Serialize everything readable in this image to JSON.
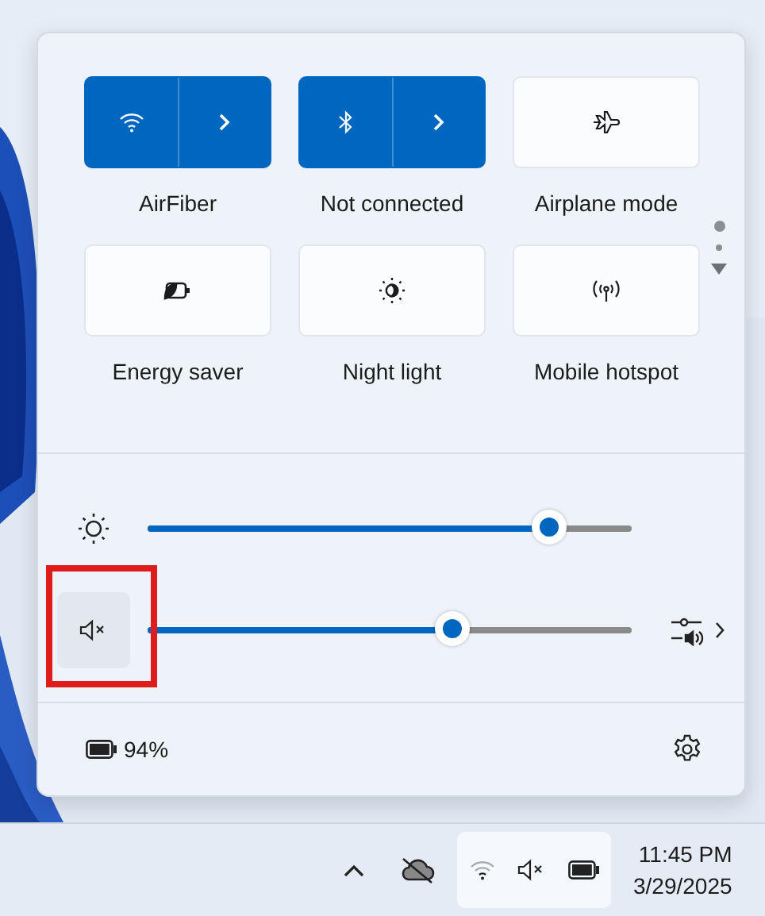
{
  "quick_settings": {
    "tiles": [
      {
        "kind": "split",
        "label": "AirFiber",
        "selected": true
      },
      {
        "kind": "split",
        "label": "Not connected",
        "selected": true
      },
      {
        "kind": "single",
        "label": "Airplane mode",
        "selected": false
      },
      {
        "kind": "single",
        "label": "Energy saver",
        "selected": false
      },
      {
        "kind": "single",
        "label": "Night light",
        "selected": false
      },
      {
        "kind": "single",
        "label": "Mobile hotspot",
        "selected": false
      }
    ],
    "pager": [
      {
        "selected": true
      },
      {
        "selected": false
      }
    ],
    "brightness": {
      "level": 0.83
    },
    "volume": {
      "level": 0.63,
      "muted": true,
      "highlighted": true
    },
    "battery": "94%"
  },
  "taskbar": {
    "time": "11:45 PM",
    "date": "3/29/2025"
  }
}
